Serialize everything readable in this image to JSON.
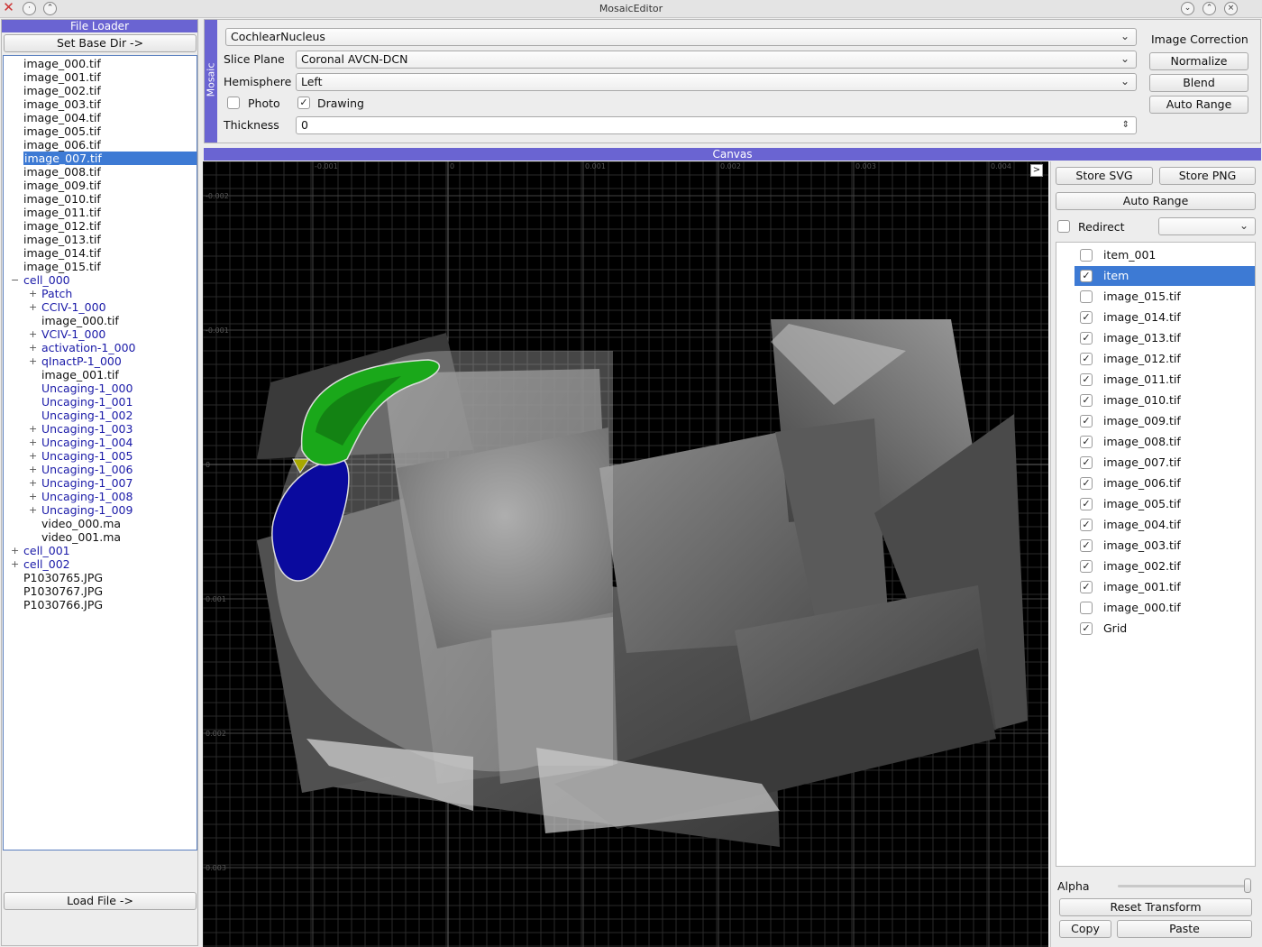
{
  "window": {
    "title": "MosaicEditor"
  },
  "file_loader": {
    "title": "File Loader",
    "set_base_dir": "Set Base Dir ->",
    "load_file": "Load File ->",
    "tree": [
      {
        "label": "image_000.tif",
        "indent": 0,
        "kind": "file",
        "expander": ""
      },
      {
        "label": "image_001.tif",
        "indent": 0,
        "kind": "file",
        "expander": ""
      },
      {
        "label": "image_002.tif",
        "indent": 0,
        "kind": "file",
        "expander": ""
      },
      {
        "label": "image_003.tif",
        "indent": 0,
        "kind": "file",
        "expander": ""
      },
      {
        "label": "image_004.tif",
        "indent": 0,
        "kind": "file",
        "expander": ""
      },
      {
        "label": "image_005.tif",
        "indent": 0,
        "kind": "file",
        "expander": ""
      },
      {
        "label": "image_006.tif",
        "indent": 0,
        "kind": "file",
        "expander": ""
      },
      {
        "label": "image_007.tif",
        "indent": 0,
        "kind": "file",
        "expander": "",
        "selected": true
      },
      {
        "label": "image_008.tif",
        "indent": 0,
        "kind": "file",
        "expander": ""
      },
      {
        "label": "image_009.tif",
        "indent": 0,
        "kind": "file",
        "expander": ""
      },
      {
        "label": "image_010.tif",
        "indent": 0,
        "kind": "file",
        "expander": ""
      },
      {
        "label": "image_011.tif",
        "indent": 0,
        "kind": "file",
        "expander": ""
      },
      {
        "label": "image_012.tif",
        "indent": 0,
        "kind": "file",
        "expander": ""
      },
      {
        "label": "image_013.tif",
        "indent": 0,
        "kind": "file",
        "expander": ""
      },
      {
        "label": "image_014.tif",
        "indent": 0,
        "kind": "file",
        "expander": ""
      },
      {
        "label": "image_015.tif",
        "indent": 0,
        "kind": "file",
        "expander": ""
      },
      {
        "label": "cell_000",
        "indent": 0,
        "kind": "dir",
        "expander": "−"
      },
      {
        "label": "Patch",
        "indent": 1,
        "kind": "dir",
        "expander": "+"
      },
      {
        "label": "CCIV-1_000",
        "indent": 1,
        "kind": "dir",
        "expander": "+"
      },
      {
        "label": "image_000.tif",
        "indent": 1,
        "kind": "file",
        "expander": ""
      },
      {
        "label": "VCIV-1_000",
        "indent": 1,
        "kind": "dir",
        "expander": "+"
      },
      {
        "label": "activation-1_000",
        "indent": 1,
        "kind": "dir",
        "expander": "+"
      },
      {
        "label": "qInactP-1_000",
        "indent": 1,
        "kind": "dir",
        "expander": "+"
      },
      {
        "label": "image_001.tif",
        "indent": 1,
        "kind": "file",
        "expander": ""
      },
      {
        "label": "Uncaging-1_000",
        "indent": 1,
        "kind": "dir",
        "expander": ""
      },
      {
        "label": "Uncaging-1_001",
        "indent": 1,
        "kind": "dir",
        "expander": ""
      },
      {
        "label": "Uncaging-1_002",
        "indent": 1,
        "kind": "dir",
        "expander": ""
      },
      {
        "label": "Uncaging-1_003",
        "indent": 1,
        "kind": "dir",
        "expander": "+"
      },
      {
        "label": "Uncaging-1_004",
        "indent": 1,
        "kind": "dir",
        "expander": "+"
      },
      {
        "label": "Uncaging-1_005",
        "indent": 1,
        "kind": "dir",
        "expander": "+"
      },
      {
        "label": "Uncaging-1_006",
        "indent": 1,
        "kind": "dir",
        "expander": "+"
      },
      {
        "label": "Uncaging-1_007",
        "indent": 1,
        "kind": "dir",
        "expander": "+"
      },
      {
        "label": "Uncaging-1_008",
        "indent": 1,
        "kind": "dir",
        "expander": "+"
      },
      {
        "label": "Uncaging-1_009",
        "indent": 1,
        "kind": "dir",
        "expander": "+"
      },
      {
        "label": "video_000.ma",
        "indent": 1,
        "kind": "file",
        "expander": ""
      },
      {
        "label": "video_001.ma",
        "indent": 1,
        "kind": "file",
        "expander": ""
      },
      {
        "label": "cell_001",
        "indent": 0,
        "kind": "dir",
        "expander": "+"
      },
      {
        "label": "cell_002",
        "indent": 0,
        "kind": "dir",
        "expander": "+"
      },
      {
        "label": "P1030765.JPG",
        "indent": 0,
        "kind": "file",
        "expander": ""
      },
      {
        "label": "P1030767.JPG",
        "indent": 0,
        "kind": "file",
        "expander": ""
      },
      {
        "label": "P1030766.JPG",
        "indent": 0,
        "kind": "file",
        "expander": ""
      }
    ]
  },
  "mosaic": {
    "tab_label": "Mosaic",
    "atlas": "CochlearNucleus",
    "slice_plane_label": "Slice Plane",
    "slice_plane": "Coronal AVCN-DCN",
    "hemisphere_label": "Hemisphere",
    "hemisphere": "Left",
    "photo_label": "Photo",
    "photo_checked": false,
    "drawing_label": "Drawing",
    "drawing_checked": true,
    "thickness_label": "Thickness",
    "thickness": "0",
    "image_correction": "Image Correction",
    "normalize": "Normalize",
    "blend": "Blend",
    "auto_range": "Auto Range"
  },
  "canvas": {
    "title": "Canvas",
    "toggle": ">",
    "x_ticks": [
      "-0.001",
      "0",
      "0.001",
      "0.002",
      "0.003",
      "0.004"
    ],
    "y_ticks": [
      "-0.002",
      "-0.001",
      "0",
      "0.001",
      "0.002",
      "0.003"
    ]
  },
  "right_panel": {
    "store_svg": "Store SVG",
    "store_png": "Store PNG",
    "auto_range": "Auto Range",
    "redirect_label": "Redirect",
    "redirect_checked": false,
    "redirect_value": "",
    "items": [
      {
        "label": "item_001",
        "checked": false,
        "selected": false
      },
      {
        "label": "item",
        "checked": true,
        "selected": true
      },
      {
        "label": "image_015.tif",
        "checked": false,
        "selected": false
      },
      {
        "label": "image_014.tif",
        "checked": true,
        "selected": false
      },
      {
        "label": "image_013.tif",
        "checked": true,
        "selected": false
      },
      {
        "label": "image_012.tif",
        "checked": true,
        "selected": false
      },
      {
        "label": "image_011.tif",
        "checked": true,
        "selected": false
      },
      {
        "label": "image_010.tif",
        "checked": true,
        "selected": false
      },
      {
        "label": "image_009.tif",
        "checked": true,
        "selected": false
      },
      {
        "label": "image_008.tif",
        "checked": true,
        "selected": false
      },
      {
        "label": "image_007.tif",
        "checked": true,
        "selected": false
      },
      {
        "label": "image_006.tif",
        "checked": true,
        "selected": false
      },
      {
        "label": "image_005.tif",
        "checked": true,
        "selected": false
      },
      {
        "label": "image_004.tif",
        "checked": true,
        "selected": false
      },
      {
        "label": "image_003.tif",
        "checked": true,
        "selected": false
      },
      {
        "label": "image_002.tif",
        "checked": true,
        "selected": false
      },
      {
        "label": "image_001.tif",
        "checked": true,
        "selected": false
      },
      {
        "label": "image_000.tif",
        "checked": false,
        "selected": false
      },
      {
        "label": "Grid",
        "checked": true,
        "selected": false
      }
    ],
    "alpha_label": "Alpha",
    "alpha_value": 1.0,
    "reset_transform": "Reset Transform",
    "copy": "Copy",
    "paste": "Paste"
  },
  "colors": {
    "accent": "#6a64d2",
    "selection": "#3d7ad4",
    "tree_link": "#1a1aa8",
    "region_green": "#1aa81a",
    "region_blue": "#0a0a9e",
    "region_yellow": "#a8a800"
  }
}
